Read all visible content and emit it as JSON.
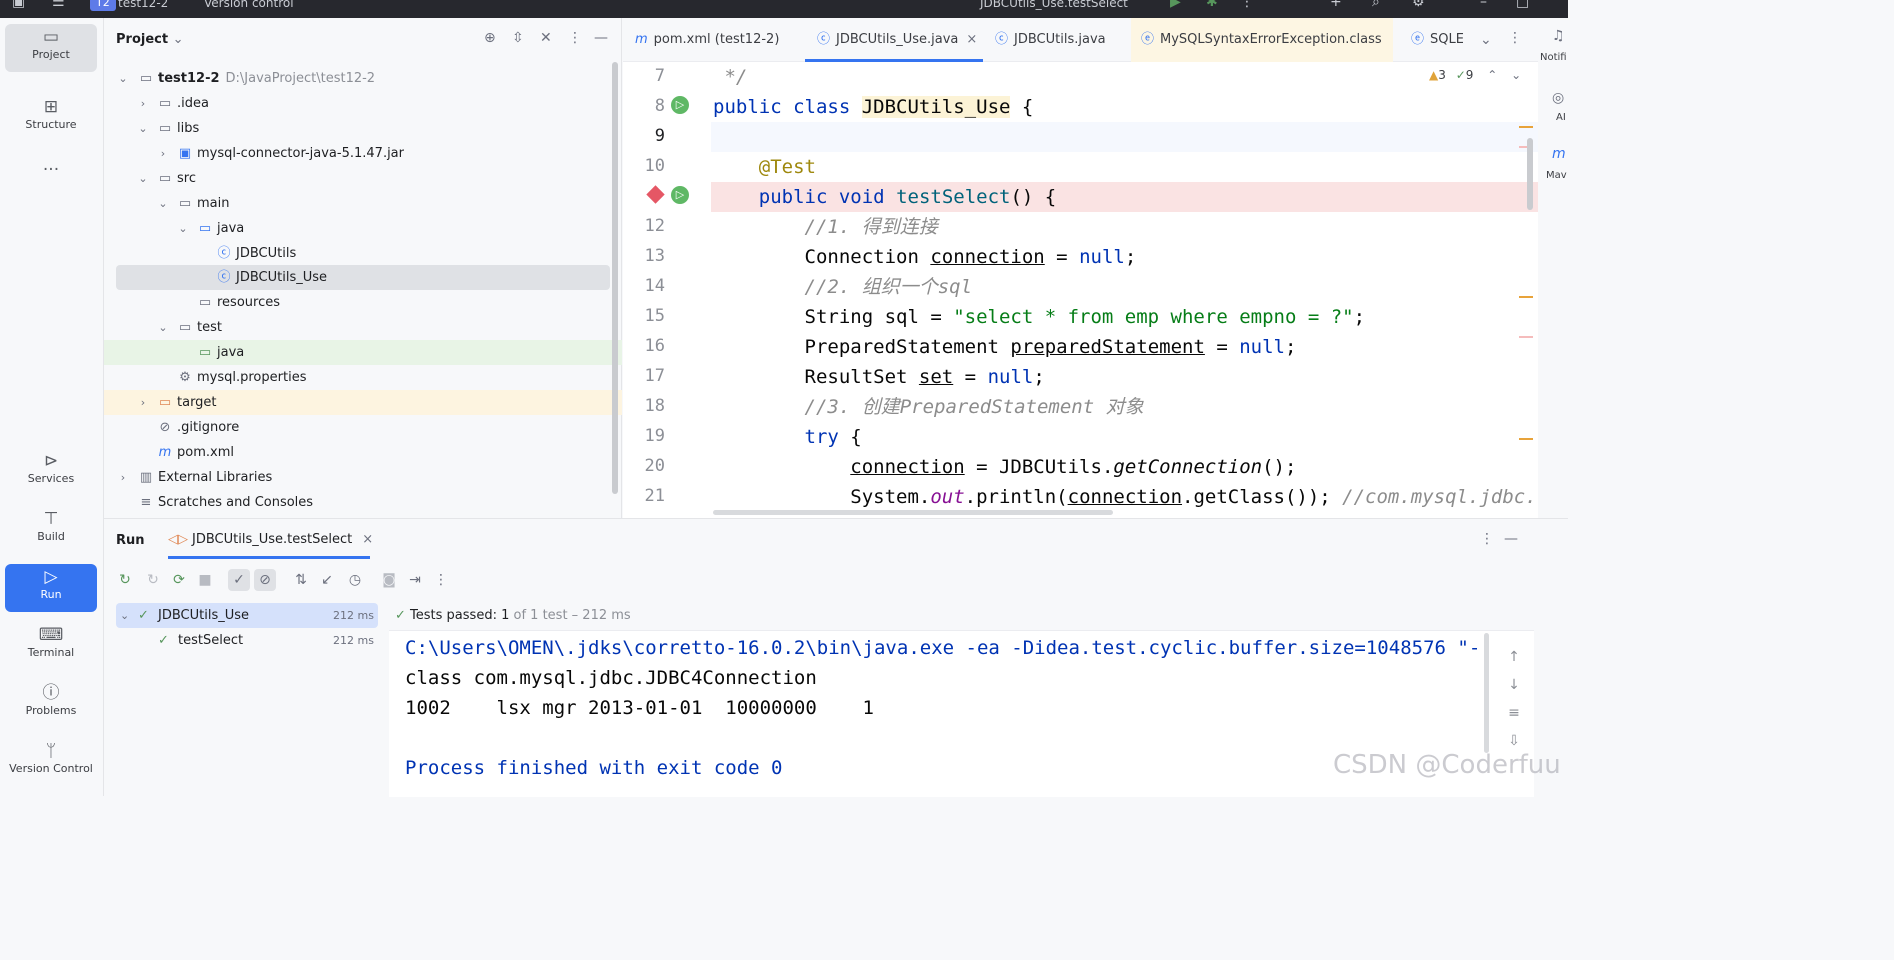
{
  "topbar": {
    "project_badge": "T2",
    "project_name": "test12-2",
    "version_control": "Version control",
    "run_config": "JDBCUtils_Use.testSelect"
  },
  "sidebar": {
    "items": [
      {
        "label": "Project"
      },
      {
        "label": "Structure"
      },
      {
        "label": "..."
      },
      {
        "label": "Services"
      },
      {
        "label": "Build"
      },
      {
        "label": "Run"
      },
      {
        "label": "Terminal"
      },
      {
        "label": "Problems"
      },
      {
        "label": "Version Control"
      }
    ]
  },
  "project": {
    "title": "Project",
    "tree": [
      {
        "label": "test12-2",
        "path": "D:\\JavaProject\\test12-2"
      },
      {
        "label": ".idea"
      },
      {
        "label": "libs"
      },
      {
        "label": "mysql-connector-java-5.1.47.jar"
      },
      {
        "label": "src"
      },
      {
        "label": "main"
      },
      {
        "label": "java"
      },
      {
        "label": "JDBCUtils"
      },
      {
        "label": "JDBCUtils_Use"
      },
      {
        "label": "resources"
      },
      {
        "label": "test"
      },
      {
        "label": "java"
      },
      {
        "label": "mysql.properties"
      },
      {
        "label": "target"
      },
      {
        "label": ".gitignore"
      },
      {
        "label": "pom.xml"
      },
      {
        "label": "External Libraries"
      },
      {
        "label": "Scratches and Consoles"
      }
    ]
  },
  "editor": {
    "tabs": [
      {
        "label": "pom.xml (test12-2)"
      },
      {
        "label": "JDBCUtils_Use.java"
      },
      {
        "label": "JDBCUtils.java"
      },
      {
        "label": "MySQLSyntaxErrorException.class"
      },
      {
        "label": "SQLE"
      }
    ],
    "warnings": "3",
    "checks": "9",
    "lines": [
      "7",
      "8",
      "9",
      "10",
      "",
      "12",
      "13",
      "14",
      "15",
      "16",
      "17",
      "18",
      "19",
      "20",
      "21"
    ]
  },
  "run": {
    "title": "Run",
    "tab_label": "JDBCUtils_Use.testSelect",
    "tests": [
      {
        "name": "JDBCUtils_Use",
        "time": "212 ms"
      },
      {
        "name": "testSelect",
        "time": "212 ms"
      }
    ],
    "status_prefix": "Tests passed: ",
    "status_count": "1",
    "status_suffix": " of 1 test – 212 ms",
    "console": [
      "C:\\Users\\OMEN\\.jdks\\corretto-16.0.2\\bin\\java.exe -ea -Didea.test.cyclic.buffer.size=1048576 \"-",
      "class com.mysql.jdbc.JDBC4Connection",
      "1002    lsx mgr 2013-01-01  10000000    1",
      "",
      "Process finished with exit code 0"
    ]
  },
  "right_rail": {
    "notifications": "Notifi",
    "ai": "AI",
    "maven": "Mav"
  },
  "watermark": "CSDN @Coderfuu"
}
